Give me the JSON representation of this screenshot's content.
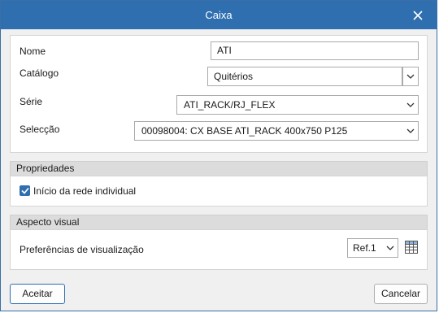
{
  "window": {
    "title": "Caixa"
  },
  "form": {
    "nome_label": "Nome",
    "nome_value": "ATI",
    "catalogo_label": "Catálogo",
    "catalogo_value": "Quitérios",
    "serie_label": "Série",
    "serie_value": "ATI_RACK/RJ_FLEX",
    "seleccao_label": "Selecção",
    "seleccao_value": "00098004: CX BASE ATI_RACK 400x750 P125"
  },
  "propriedades": {
    "header": "Propriedades",
    "checkbox_label": "Início da rede individual",
    "checked": true
  },
  "aspecto": {
    "header": "Aspecto visual",
    "pref_label": "Preferências de visualização",
    "pref_value": "Ref.1"
  },
  "buttons": {
    "accept": "Aceitar",
    "cancel": "Cancelar"
  },
  "colors": {
    "titlebar": "#2f6fb0",
    "accent": "#2f6fb0"
  }
}
